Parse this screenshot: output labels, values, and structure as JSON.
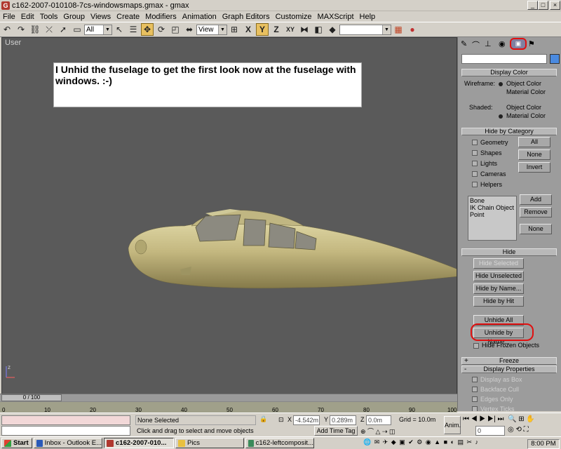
{
  "window": {
    "title": "c162-2007-010108-7cs-windowsmaps.gmax - gmax",
    "controls": [
      "_",
      "□",
      "×"
    ]
  },
  "menu": [
    "File",
    "Edit",
    "Tools",
    "Group",
    "Views",
    "Create",
    "Modifiers",
    "Animation",
    "Graph Editors",
    "Customize",
    "MAXScript",
    "Help"
  ],
  "toolbar": {
    "selection_filter": "All",
    "reference_coord": "View",
    "named_selection": ""
  },
  "viewport": {
    "label": "User",
    "annotation": "I Unhid the fuselage to get the first look now at the fuselage with windows. :-)"
  },
  "command_panel": {
    "display_color": {
      "header": "Display Color",
      "wireframe_label": "Wireframe:",
      "shaded_label": "Shaded:",
      "object_color": "Object Color",
      "material_color": "Material Color"
    },
    "hide_by_category": {
      "header": "Hide by Category",
      "categories": [
        "Geometry",
        "Shapes",
        "Lights",
        "Cameras",
        "Helpers"
      ],
      "all": "All",
      "none": "None",
      "invert": "Invert",
      "list": [
        "Bone",
        "IK Chain Object",
        "Point"
      ],
      "add": "Add",
      "remove": "Remove",
      "none2": "None"
    },
    "hide": {
      "header": "Hide",
      "hide_selected": "Hide Selected",
      "hide_unselected": "Hide Unselected",
      "hide_by_name": "Hide by Name...",
      "hide_by_hit": "Hide by Hit",
      "unhide_all": "Unhide All",
      "unhide_by_name": "Unhide by Name...",
      "hide_frozen": "Hide Frozen Objects"
    },
    "freeze": {
      "header": "Freeze",
      "sign": "+"
    },
    "display_properties": {
      "header": "Display Properties",
      "sign": "-",
      "items": [
        "Display as Box",
        "Backface Cull",
        "Edges Only",
        "Vertex Ticks"
      ]
    }
  },
  "timeline": {
    "slider": "0 / 100",
    "ticks": [
      "0",
      "10",
      "20",
      "30",
      "40",
      "50",
      "60",
      "70",
      "80",
      "90",
      "100"
    ]
  },
  "status": {
    "selection": "None Selected",
    "prompt": "Click and drag to select and move objects",
    "x_label": "X",
    "x_value": "-4.542m",
    "y_label": "Y",
    "y_value": "0.289m",
    "z_label": "Z",
    "z_value": "0.0m",
    "grid": "Grid = 10.0m",
    "add_time_tag": "Add Time Tag",
    "anim": "Anim.",
    "frame": "0"
  },
  "taskbar": {
    "start": "Start",
    "tasks": [
      "Inbox - Outlook E...",
      "c162-2007-010...",
      "Pics",
      "c162-leftcomposit..."
    ],
    "clock": "8:00 PM"
  }
}
